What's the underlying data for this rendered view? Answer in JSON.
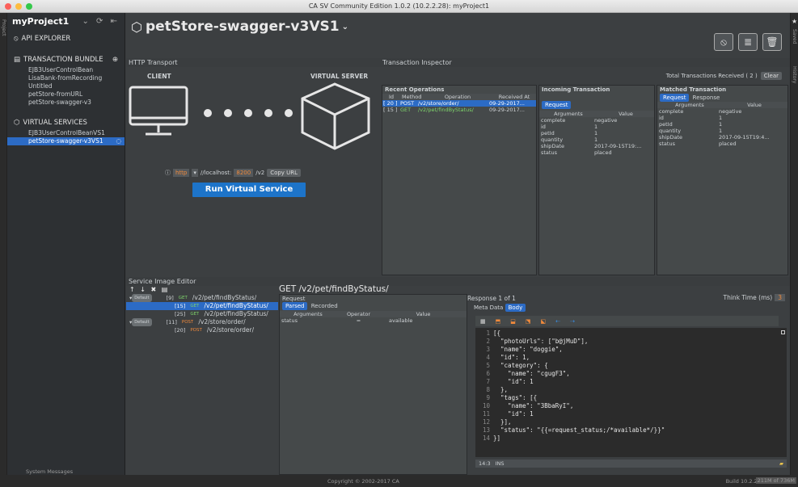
{
  "window": {
    "title": "CA SV Community Edition 1.0.2 (10.2.2.28): myProject1"
  },
  "strips": {
    "left": "Project",
    "right_top": "Saved",
    "right_bottom": "History"
  },
  "sidebar": {
    "project": "myProject1",
    "api_explorer": "API EXPLORER",
    "bundle_title": "TRANSACTION BUNDLE",
    "bundles": [
      "EJB3UserControlBean",
      "LisaBank-fromRecording",
      "Untitled",
      "petStore-fromURL",
      "petStore-swagger-v3"
    ],
    "vs_title": "VIRTUAL SERVICES",
    "services": [
      "EJB3UserControlBeanVS1",
      "petStore-swagger-v3VS1"
    ]
  },
  "header": {
    "service_name": "petStore-swagger-v3VS1"
  },
  "transport": {
    "title": "HTTP Transport",
    "client": "CLIENT",
    "server": "VIRTUAL SERVER",
    "protocol": "http",
    "host": "//localhost:",
    "port": "8200",
    "path": "/v2",
    "copy": "Copy URL",
    "run": "Run Virtual Service"
  },
  "inspector": {
    "title": "Transaction Inspector",
    "total": "Total Transactions Received ( 2 )",
    "clear": "Clear",
    "recent": {
      "title": "Recent Operations",
      "cols": [
        "Id",
        "Method",
        "Operation",
        "Received At"
      ],
      "rows": [
        {
          "id": "[ 20 ]",
          "method": "POST",
          "op": "/v2/store/order/",
          "at": "09-29-2017..."
        },
        {
          "id": "[ 15 ]",
          "method": "GET",
          "op": "/v2/pet/findByStatus/",
          "at": "09-29-2017..."
        }
      ]
    },
    "incoming": {
      "title": "Incoming Transaction",
      "tab": "Request",
      "cols": [
        "Arguments",
        "Value"
      ],
      "rows": [
        [
          "complete",
          "negative"
        ],
        [
          "id",
          "1"
        ],
        [
          "petId",
          "1"
        ],
        [
          "quantity",
          "1"
        ],
        [
          "shipDate",
          "2017-09-15T19:..."
        ],
        [
          "status",
          "placed"
        ]
      ]
    },
    "matched": {
      "title": "Matched Transaction",
      "tab1": "Request",
      "tab2": "Response",
      "cols": [
        "Arguments",
        "Value"
      ],
      "rows": [
        [
          "complete",
          "negative"
        ],
        [
          "id",
          "1"
        ],
        [
          "petId",
          "1"
        ],
        [
          "quantity",
          "1"
        ],
        [
          "shipDate",
          "2017-09-15T19:4..."
        ],
        [
          "status",
          "placed"
        ]
      ]
    }
  },
  "editor": {
    "title": "Service Image Editor",
    "toolbar": "↑ ↓ ✖ ▤",
    "tree": [
      {
        "badge": "Default",
        "id": "[9]",
        "method": "GET",
        "path": "/v2/pet/findByStatus/",
        "level": 0
      },
      {
        "badge": "",
        "id": "[15]",
        "method": "GET",
        "path": "/v2/pet/findByStatus/",
        "level": 1
      },
      {
        "badge": "",
        "id": "[25]",
        "method": "GET",
        "path": "/v2/pet/findByStatus/",
        "level": 1
      },
      {
        "badge": "Default",
        "id": "[11]",
        "method": "POST",
        "path": "/v2/store/order/",
        "level": 0
      },
      {
        "badge": "",
        "id": "[20]",
        "method": "POST",
        "path": "/v2/store/order/",
        "level": 1
      }
    ],
    "op_title": "GET /v2/pet/findByStatus/",
    "request": "Request",
    "parsed": "Parsed",
    "recorded": "Recorded",
    "req_cols": [
      "Arguments",
      "Operator",
      "Value"
    ],
    "req_row": [
      "status",
      "=",
      "available"
    ],
    "response_label": "Response 1 of 1",
    "think_time": "Think Time (ms)",
    "think_value": "3",
    "meta": "Meta Data",
    "body": "Body",
    "code_lines": [
      "[{",
      "  \"photoUrls\": [\"b@jMuD\"],",
      "  \"name\": \"doggie\",",
      "  \"id\": 1,",
      "  \"category\": {",
      "    \"name\": \"cgugF3\",",
      "    \"id\": 1",
      "  },",
      "  \"tags\": [{",
      "    \"name\": \"3BbaRyI\",",
      "    \"id\": 1",
      "  }],",
      "  \"status\": \"{{=request_status;/*available*/}}\"",
      "}]"
    ],
    "cursor": "14:3",
    "mode": "INS"
  },
  "footer": {
    "messages": "System Messages",
    "copyright": "Copyright © 2002-2017 CA",
    "build": "Build 10.2.2.28",
    "memory": "211M of 736M"
  },
  "colors": {
    "accent": "#2c6bc5",
    "get": "#7ed36b",
    "post": "#f08a3c",
    "selection": "#2c6bc5"
  }
}
